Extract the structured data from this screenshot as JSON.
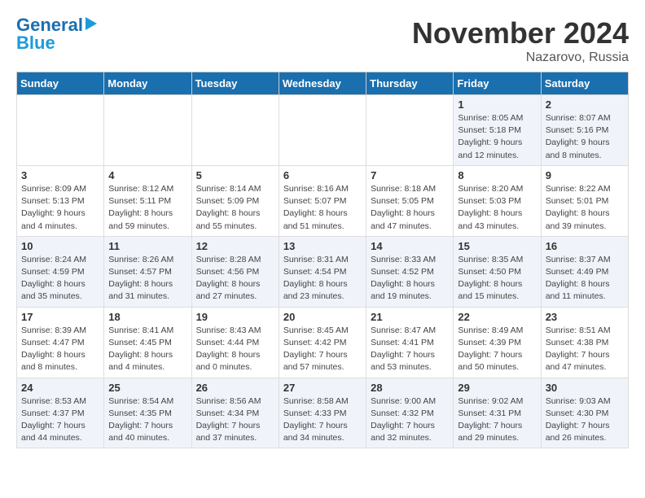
{
  "logo": {
    "line1": "General",
    "line2": "Blue"
  },
  "header": {
    "title": "November 2024",
    "subtitle": "Nazarovo, Russia"
  },
  "weekdays": [
    "Sunday",
    "Monday",
    "Tuesday",
    "Wednesday",
    "Thursday",
    "Friday",
    "Saturday"
  ],
  "weeks": [
    [
      {
        "day": "",
        "info": ""
      },
      {
        "day": "",
        "info": ""
      },
      {
        "day": "",
        "info": ""
      },
      {
        "day": "",
        "info": ""
      },
      {
        "day": "",
        "info": ""
      },
      {
        "day": "1",
        "info": "Sunrise: 8:05 AM\nSunset: 5:18 PM\nDaylight: 9 hours and 12 minutes."
      },
      {
        "day": "2",
        "info": "Sunrise: 8:07 AM\nSunset: 5:16 PM\nDaylight: 9 hours and 8 minutes."
      }
    ],
    [
      {
        "day": "3",
        "info": "Sunrise: 8:09 AM\nSunset: 5:13 PM\nDaylight: 9 hours and 4 minutes."
      },
      {
        "day": "4",
        "info": "Sunrise: 8:12 AM\nSunset: 5:11 PM\nDaylight: 8 hours and 59 minutes."
      },
      {
        "day": "5",
        "info": "Sunrise: 8:14 AM\nSunset: 5:09 PM\nDaylight: 8 hours and 55 minutes."
      },
      {
        "day": "6",
        "info": "Sunrise: 8:16 AM\nSunset: 5:07 PM\nDaylight: 8 hours and 51 minutes."
      },
      {
        "day": "7",
        "info": "Sunrise: 8:18 AM\nSunset: 5:05 PM\nDaylight: 8 hours and 47 minutes."
      },
      {
        "day": "8",
        "info": "Sunrise: 8:20 AM\nSunset: 5:03 PM\nDaylight: 8 hours and 43 minutes."
      },
      {
        "day": "9",
        "info": "Sunrise: 8:22 AM\nSunset: 5:01 PM\nDaylight: 8 hours and 39 minutes."
      }
    ],
    [
      {
        "day": "10",
        "info": "Sunrise: 8:24 AM\nSunset: 4:59 PM\nDaylight: 8 hours and 35 minutes."
      },
      {
        "day": "11",
        "info": "Sunrise: 8:26 AM\nSunset: 4:57 PM\nDaylight: 8 hours and 31 minutes."
      },
      {
        "day": "12",
        "info": "Sunrise: 8:28 AM\nSunset: 4:56 PM\nDaylight: 8 hours and 27 minutes."
      },
      {
        "day": "13",
        "info": "Sunrise: 8:31 AM\nSunset: 4:54 PM\nDaylight: 8 hours and 23 minutes."
      },
      {
        "day": "14",
        "info": "Sunrise: 8:33 AM\nSunset: 4:52 PM\nDaylight: 8 hours and 19 minutes."
      },
      {
        "day": "15",
        "info": "Sunrise: 8:35 AM\nSunset: 4:50 PM\nDaylight: 8 hours and 15 minutes."
      },
      {
        "day": "16",
        "info": "Sunrise: 8:37 AM\nSunset: 4:49 PM\nDaylight: 8 hours and 11 minutes."
      }
    ],
    [
      {
        "day": "17",
        "info": "Sunrise: 8:39 AM\nSunset: 4:47 PM\nDaylight: 8 hours and 8 minutes."
      },
      {
        "day": "18",
        "info": "Sunrise: 8:41 AM\nSunset: 4:45 PM\nDaylight: 8 hours and 4 minutes."
      },
      {
        "day": "19",
        "info": "Sunrise: 8:43 AM\nSunset: 4:44 PM\nDaylight: 8 hours and 0 minutes."
      },
      {
        "day": "20",
        "info": "Sunrise: 8:45 AM\nSunset: 4:42 PM\nDaylight: 7 hours and 57 minutes."
      },
      {
        "day": "21",
        "info": "Sunrise: 8:47 AM\nSunset: 4:41 PM\nDaylight: 7 hours and 53 minutes."
      },
      {
        "day": "22",
        "info": "Sunrise: 8:49 AM\nSunset: 4:39 PM\nDaylight: 7 hours and 50 minutes."
      },
      {
        "day": "23",
        "info": "Sunrise: 8:51 AM\nSunset: 4:38 PM\nDaylight: 7 hours and 47 minutes."
      }
    ],
    [
      {
        "day": "24",
        "info": "Sunrise: 8:53 AM\nSunset: 4:37 PM\nDaylight: 7 hours and 44 minutes."
      },
      {
        "day": "25",
        "info": "Sunrise: 8:54 AM\nSunset: 4:35 PM\nDaylight: 7 hours and 40 minutes."
      },
      {
        "day": "26",
        "info": "Sunrise: 8:56 AM\nSunset: 4:34 PM\nDaylight: 7 hours and 37 minutes."
      },
      {
        "day": "27",
        "info": "Sunrise: 8:58 AM\nSunset: 4:33 PM\nDaylight: 7 hours and 34 minutes."
      },
      {
        "day": "28",
        "info": "Sunrise: 9:00 AM\nSunset: 4:32 PM\nDaylight: 7 hours and 32 minutes."
      },
      {
        "day": "29",
        "info": "Sunrise: 9:02 AM\nSunset: 4:31 PM\nDaylight: 7 hours and 29 minutes."
      },
      {
        "day": "30",
        "info": "Sunrise: 9:03 AM\nSunset: 4:30 PM\nDaylight: 7 hours and 26 minutes."
      }
    ]
  ]
}
